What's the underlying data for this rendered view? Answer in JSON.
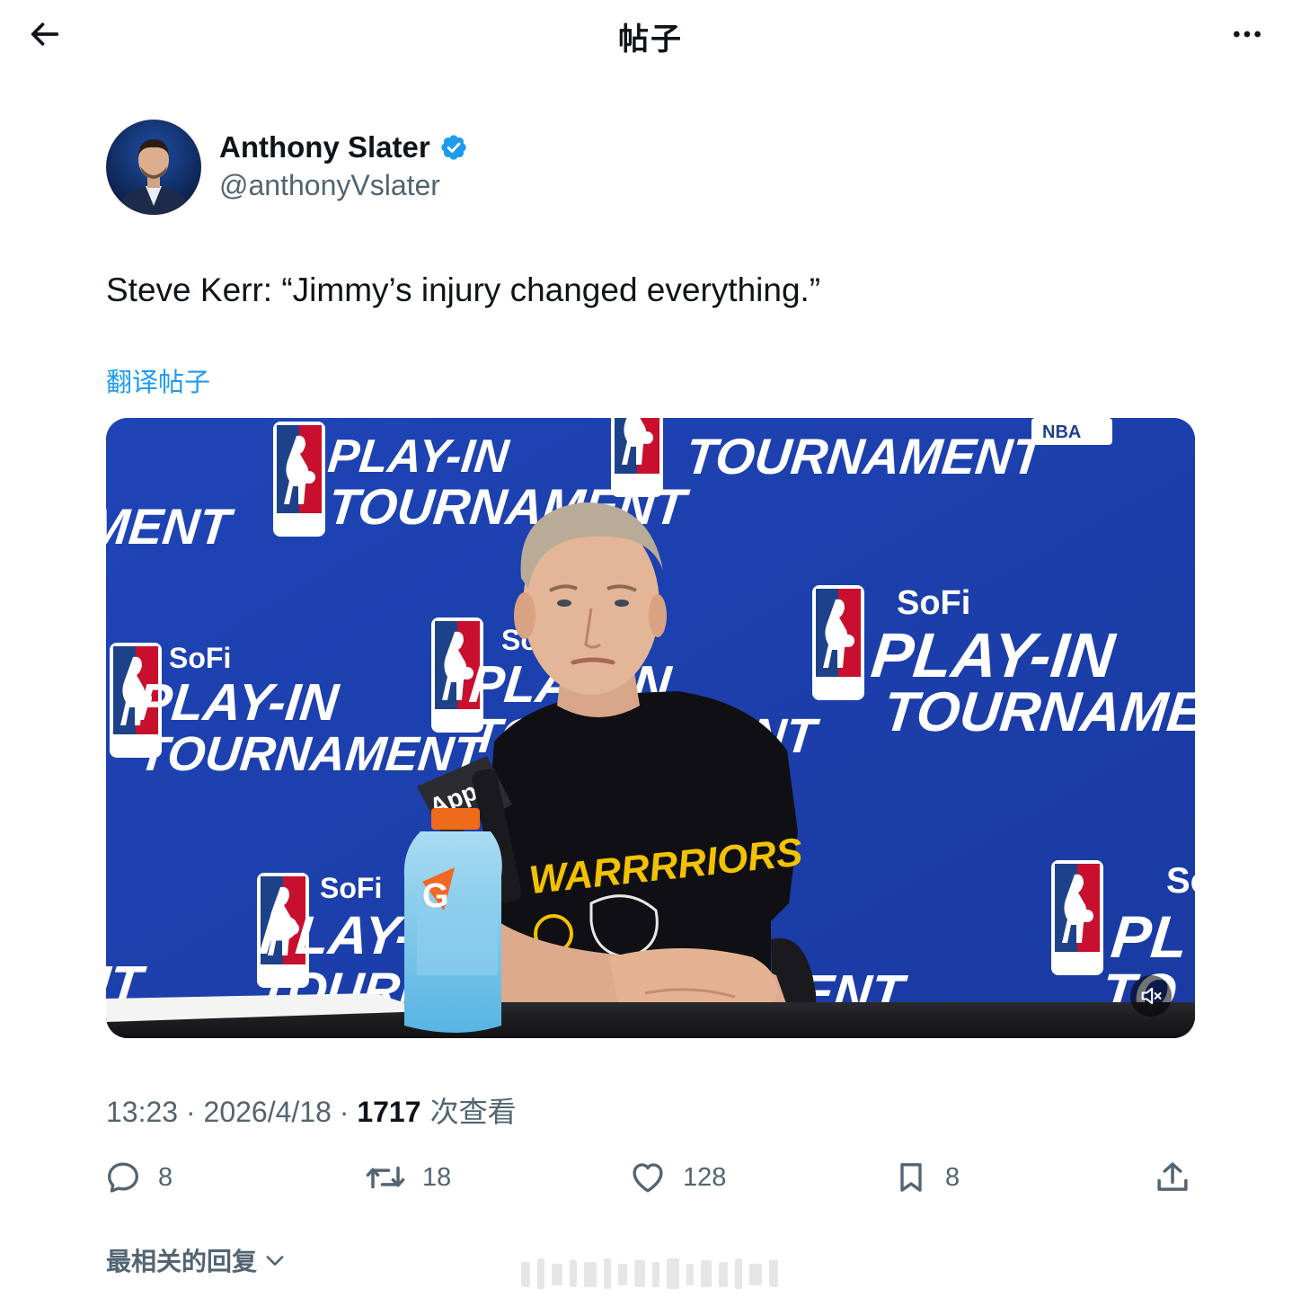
{
  "header": {
    "title": "帖子",
    "back_icon": "arrow-left-icon",
    "more_icon": "more-horizontal-icon"
  },
  "author": {
    "name": "Anthony Slater",
    "handle": "@anthonyVslater",
    "verified": true,
    "verified_color": "#1d9bf0"
  },
  "post": {
    "text": "Steve Kerr: “Jimmy’s injury changed everything.”",
    "translate_label": "翻译帖子",
    "time": "13:23",
    "separator": " · ",
    "date": "2026/4/18",
    "views_count": "1717",
    "views_label": " 次查看"
  },
  "media": {
    "type": "video",
    "banner_top_line": "SoFi",
    "banner_mid_line": "PLAY-IN",
    "banner_bottom_line": "TOURNAMENT",
    "league_label": "NBA",
    "mic_label": "App",
    "shirt_text": "WARRRRIORS",
    "bottle_logo": "G",
    "muted_icon": "volume-mute-icon"
  },
  "actions": {
    "reply": {
      "icon": "reply-icon",
      "count": "8"
    },
    "repost": {
      "icon": "repost-icon",
      "count": "18"
    },
    "like": {
      "icon": "heart-icon",
      "count": "128"
    },
    "bookmark": {
      "icon": "bookmark-icon",
      "count": "8"
    },
    "share": {
      "icon": "share-icon"
    }
  },
  "replies": {
    "sort_label": "最相关的回复",
    "chevron_icon": "chevron-down-icon"
  },
  "colors": {
    "text_primary": "#0f1419",
    "text_secondary": "#536471",
    "link": "#1d9bf0",
    "backdrop_blue": "#1d3fae"
  }
}
